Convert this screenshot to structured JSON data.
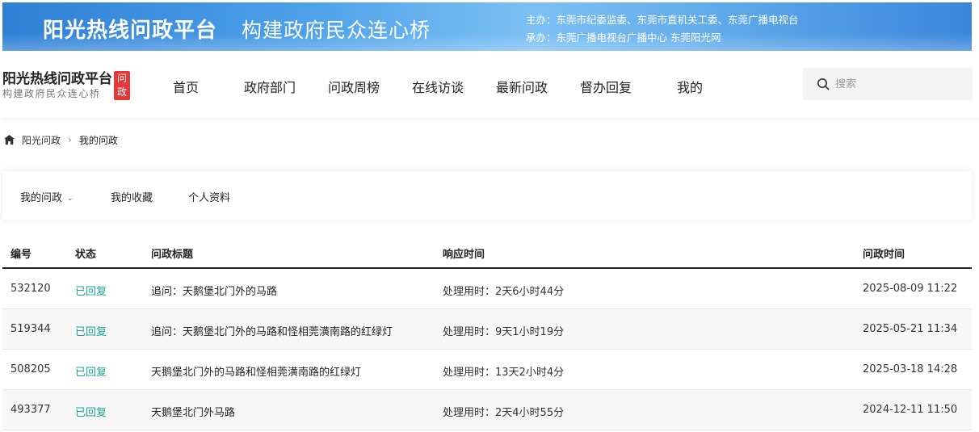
{
  "banner": {
    "title": "阳光热线问政平台",
    "slogan": "构建政府民众连心桥",
    "host_line": "主办：东莞市纪委监委、东莞市直机关工委、东莞广播电视台",
    "organizer_line": "承办：东莞广播电视台广播中心 东莞阳光网"
  },
  "logo": {
    "main": "阳光热线问政平台",
    "sub": "构建政府民众连心桥",
    "badge_top": "问",
    "badge_bottom": "政"
  },
  "nav": {
    "items": [
      "首页",
      "政府部门",
      "问政周榜",
      "在线访谈",
      "最新问政",
      "督办回复",
      "我的"
    ]
  },
  "search": {
    "placeholder": "搜索"
  },
  "breadcrumb": {
    "home": "阳光问政",
    "sep": "›",
    "current": "我的问政"
  },
  "tabs": {
    "items": [
      "我的问政",
      "我的收藏",
      "个人资料"
    ],
    "dropdown_glyph": "⌄"
  },
  "table": {
    "headers": [
      "编号",
      "状态",
      "问政标题",
      "响应时间",
      "问政时间"
    ],
    "rows": [
      {
        "id": "532120",
        "status": "已回复",
        "title": "追问：天鹅堡北门外的马路",
        "response": "处理用时：2天6小时44分",
        "time": "2025-08-09 11:22"
      },
      {
        "id": "519344",
        "status": "已回复",
        "title": "追问：天鹅堡北门外的马路和怪相莞潢南路的红绿灯",
        "response": "处理用时：9天1小时19分",
        "time": "2025-05-21 11:34"
      },
      {
        "id": "508205",
        "status": "已回复",
        "title": "天鹅堡北门外的马路和怪相莞潢南路的红绿灯",
        "response": "处理用时：13天2小时4分",
        "time": "2025-03-18 14:28"
      },
      {
        "id": "493377",
        "status": "已回复",
        "title": "天鹅堡北门外马路",
        "response": "处理用时：2天4小时55分",
        "time": "2024-12-11 11:50"
      }
    ]
  },
  "colors": {
    "status_replied": "#1aa39a",
    "badge": "#e5383b",
    "banner_blue": "#3a86dc"
  }
}
